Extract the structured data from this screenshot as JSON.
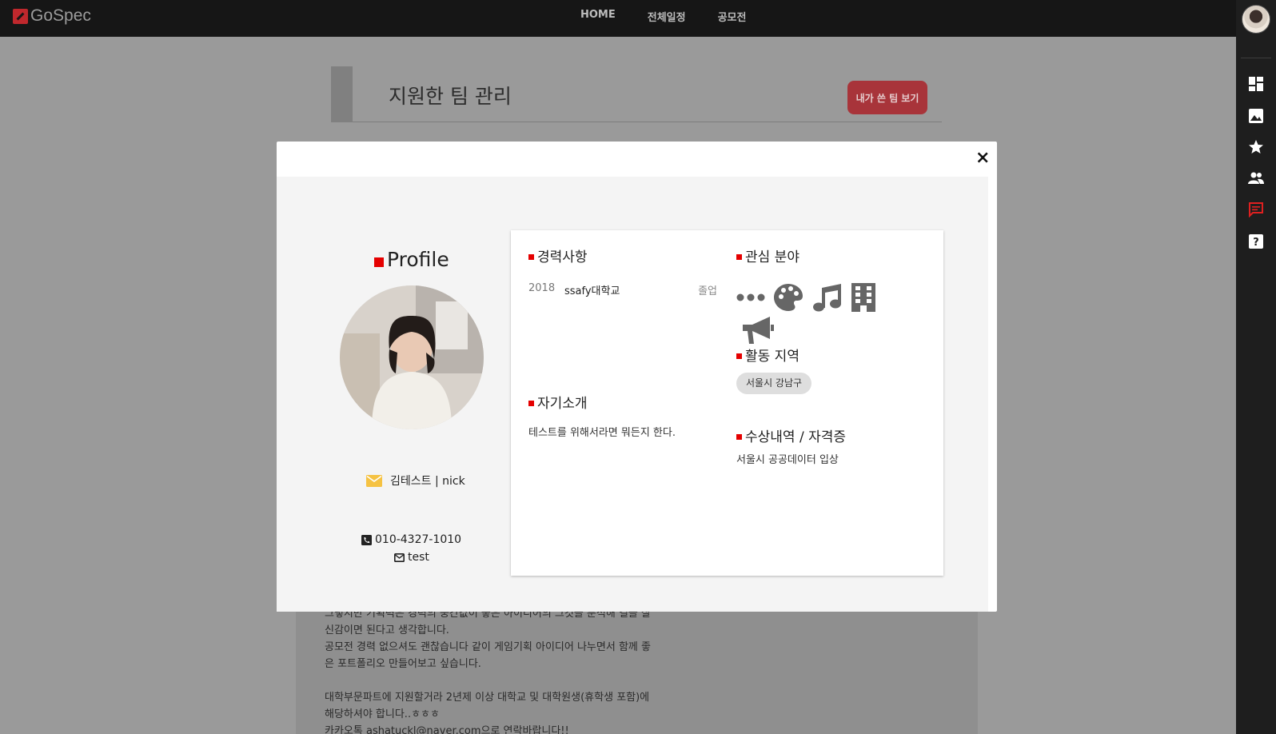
{
  "brand": {
    "name": "GoSpec"
  },
  "nav": {
    "items": [
      "HOME",
      "전체일정",
      "공모전"
    ]
  },
  "sidebar": {
    "icons": [
      "dashboard-icon",
      "image-icon",
      "star-icon",
      "people-icon",
      "chat-icon",
      "help-icon"
    ],
    "active_color": "#e02020"
  },
  "page": {
    "title": "지원한 팀 관리",
    "my_team_button": "내가 쓴 팀 보기",
    "bg_text": [
      "그렇지만 기획력은 경력의 중간값이 좋은 아이디어의 그것을 분석해 결을 살",
      "신감이면 된다고 생각합니다.",
      "공모전 경력 없으셔도 괜찮습니다 같이 게임기획 아이디어 나누면서 함께 좋",
      "은 포트폴리오 만들어보고 싶습니다.",
      "",
      "대학부문파트에 지원할거라 2년제 이상 대학교 및 대학원생(휴학생 포함)에",
      "해당하셔야 합니다..ㅎㅎㅎ",
      "카카오톡 ashatuckl@naver.com으로 연락바랍니다!!"
    ]
  },
  "modal": {
    "close_label": "×",
    "profile": {
      "title": "Profile",
      "name_line": "김테스트 | nick",
      "phone": "010-4327-1010",
      "email": "test"
    },
    "career": {
      "heading": "경력사항",
      "items": [
        {
          "year": "2018",
          "school": "ssafy대학교",
          "status": "졸업"
        }
      ]
    },
    "intro": {
      "heading": "자기소개",
      "text": "테스트를 위해서라면 뭐든지 한다."
    },
    "interests": {
      "heading": "관심 분야",
      "icons": [
        "more-dots-icon",
        "palette-icon",
        "music-note-icon",
        "building-icon",
        "megaphone-icon"
      ]
    },
    "region": {
      "heading": "활동 지역",
      "chip": "서울시 강남구"
    },
    "awards": {
      "heading": "수상내역 / 자격증",
      "text": "서울시 공공데이터 입상"
    }
  },
  "colors": {
    "accent_red": "#e50000",
    "button_red": "#a8343a",
    "mail_icon_yellow": "#f5c242"
  }
}
